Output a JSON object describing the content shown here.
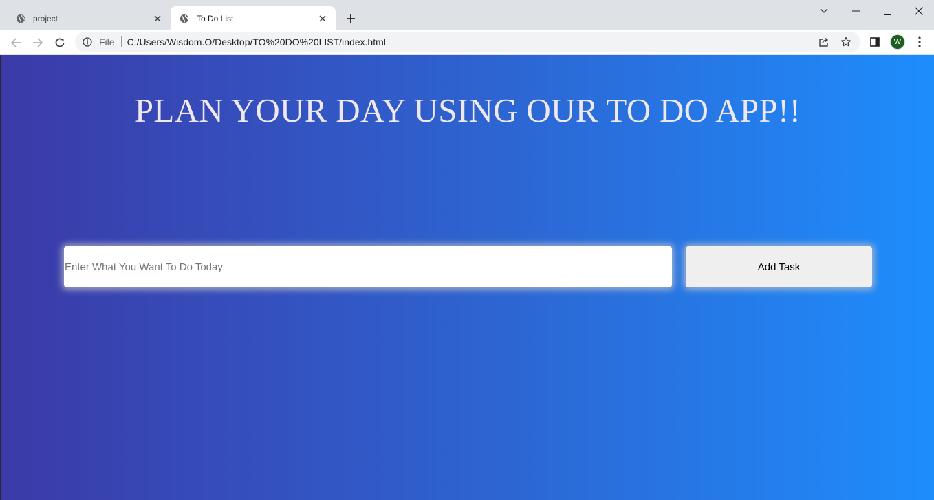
{
  "browser": {
    "tabs": [
      {
        "title": "project",
        "active": false
      },
      {
        "title": "To Do List",
        "active": true
      }
    ],
    "address_bar": {
      "scheme_label": "File",
      "url": "C:/Users/Wisdom.O/Desktop/TO%20DO%20LIST/index.html"
    },
    "profile_initial": "W",
    "icons": {
      "tab_favicon": "globe-icon",
      "new_tab": "plus-icon",
      "back": "arrow-left-icon",
      "forward": "arrow-right-icon",
      "reload": "reload-icon",
      "site_info": "info-icon",
      "share": "share-icon",
      "bookmark": "star-icon",
      "side_panel": "side-panel-icon",
      "menu": "kebab-menu-icon"
    }
  },
  "page": {
    "heading": "PLAN YOUR DAY USING OUR TO DO APP!!",
    "task_input": {
      "placeholder": "Enter What You Want To Do Today",
      "value": ""
    },
    "add_button_label": "Add Task"
  },
  "colors": {
    "gradient_start": "#3b3aa8",
    "gradient_end": "#1e8dfc",
    "heading_color": "#efe9ee",
    "avatar_bg": "#1e5e20"
  }
}
